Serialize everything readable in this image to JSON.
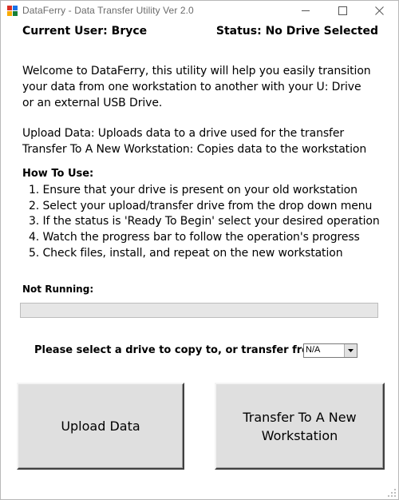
{
  "window": {
    "title": "DataFerry - Data Transfer Utility Ver 2.0"
  },
  "icons": {
    "app": "dataferry-app-icon",
    "minimize": "minimize-icon",
    "maximize": "maximize-icon",
    "close": "close-icon",
    "dropdown": "chevron-down-icon"
  },
  "header": {
    "user": "Current User: Bryce",
    "status": "Status: No Drive Selected"
  },
  "intro": {
    "welcome": "Welcome to DataFerry, this utility will help you easily transition your data from one workstation to another with your U: Drive or an external USB Drive.",
    "upload_desc": "Upload Data: Uploads data to a drive used for the transfer",
    "transfer_desc": "Transfer To A New Workstation: Copies data to the workstation"
  },
  "howto": {
    "title": "How To Use:",
    "steps": [
      "1. Ensure that your drive is present on your old workstation",
      "2. Select your upload/transfer drive from the drop down menu",
      "3. If the status is 'Ready To Begin' select your desired operation",
      "4. Watch the progress bar to follow the operation's progress",
      "5. Check files, install, and repeat on the new workstation"
    ]
  },
  "progress": {
    "label": "Not Running:",
    "value": 0
  },
  "drive": {
    "prompt": "Please select a drive to copy to, or transfer from:",
    "selected": "N/A"
  },
  "buttons": {
    "upload": "Upload Data",
    "transfer": "Transfer To A New Workstation"
  },
  "colors": {
    "button_face": "#dfdfdf",
    "progress_track": "#e6e6e6",
    "progress_fill": "#06b025",
    "title_text": "#6b6b6b"
  }
}
